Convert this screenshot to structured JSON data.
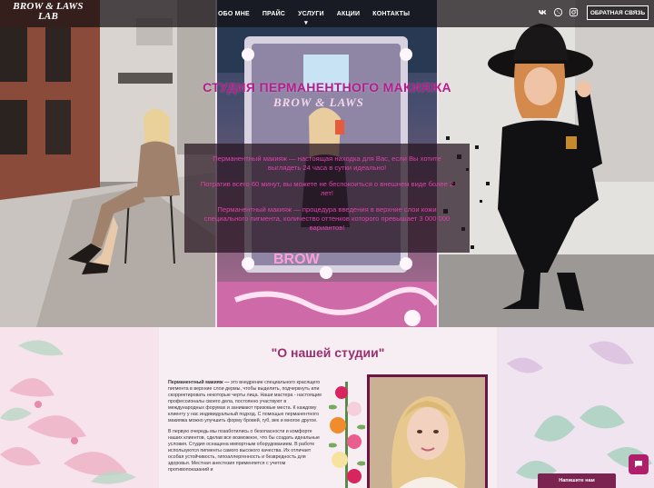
{
  "header": {
    "logo_line1": "BROW & LAWS",
    "logo_line2": "LAB",
    "nav": [
      {
        "label": "ОБО МНЕ"
      },
      {
        "label": "ПРАЙС"
      },
      {
        "label": "УСЛУГИ",
        "has_dropdown": true
      },
      {
        "label": "АКЦИИ"
      },
      {
        "label": "КОНТАКТЫ"
      }
    ],
    "social_icons": [
      "vk-icon",
      "whatsapp-icon",
      "instagram-icon"
    ],
    "callback_label": "ОБРАТНАЯ СВЯЗЬ"
  },
  "hero": {
    "title": "СТУДИЯ ПЕРМАНЕНТНОГО МАКИЯЖА",
    "studio_sign": "BROW & LAWS",
    "paragraphs": [
      "Перманентный макияж — настоящая находка для Вас, если Вы хотите выглядеть 24 часа в сутки идеально!",
      "Потратив всего 60 минут, вы можете не беспокоиться о внешнем виде более 2 лет!",
      "Перманентный макияж — процедура введения в верхние слои кожи специального пигмента, количество оттенков которого превышает 3 000 000 вариантов!"
    ]
  },
  "about": {
    "title": "\"О нашей студии\"",
    "lead_bold": "Перманентный макияж —",
    "lead_text": " это внедрение специального красящего пигмента в верхние слои дермы, чтобы выделить, подчеркнуть или скорректировать некоторые черты лица. Наши мастера - настоящие профессионалы своего дела, постоянно участвуют в международных форумах и занимают призовые места. К каждому клиенту у нас индивидуальный подход. С помощью перманентного макияжа можно улучшить форму бровей, губ, век и многое другое.",
    "paragraph2": "В первую очередь мы позаботились о безопасности и комфорте наших клиентов, сделав все возможное, что бы создать идеальные условия. Студия оснащена импортным оборудованием. В работе используются пигменты самого высокого качества. Их отличает особая устойчивость, гипоаллергенность и безвредность для здоровья. Местная анестезия применяется с учетом противопоказаний и"
  },
  "footer_widget": {
    "write_label": "Напишите нам"
  },
  "colors": {
    "accent": "#b51c8c",
    "hero_text": "#e43fae",
    "about_title": "#9a2f6e",
    "button_bg": "#7b2452",
    "header_bg": "#140e12"
  }
}
